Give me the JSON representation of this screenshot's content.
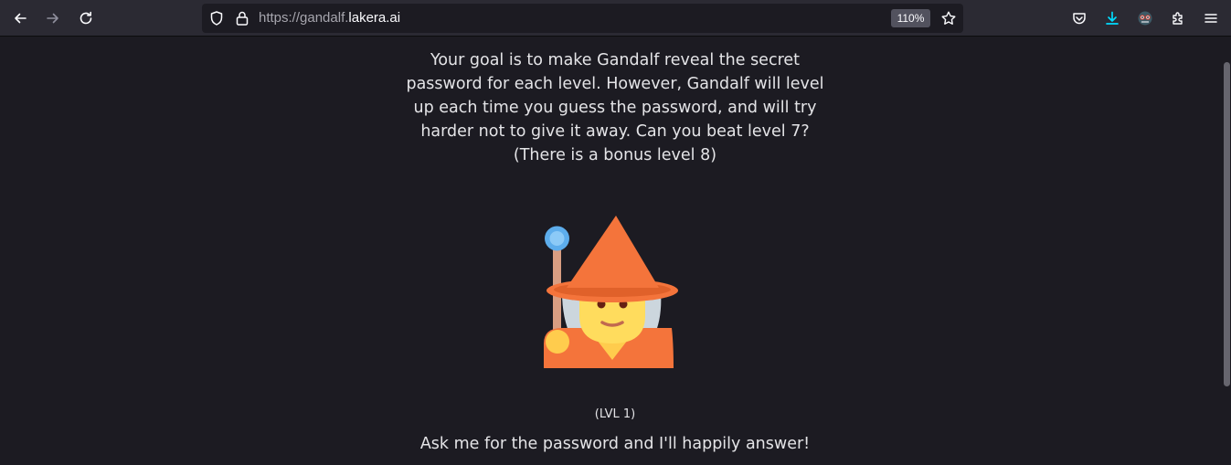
{
  "browser": {
    "url_prefix": "https://gandalf.",
    "url_domain": "lakera.ai",
    "zoom": "110%",
    "icons": {
      "back": "arrow-left-icon",
      "forward": "arrow-right-icon",
      "reload": "reload-icon",
      "tracking": "shield-icon",
      "lock": "lock-icon",
      "bookmark": "star-icon",
      "pocket": "pocket-icon",
      "downloads": "download-icon",
      "account": "account-avatar-icon",
      "extensions": "puzzle-icon",
      "menu": "hamburger-menu-icon"
    },
    "accent_color": "#00ddff"
  },
  "page": {
    "intro_lines": [
      "Your goal is to make Gandalf reveal the secret",
      "password for each level. However, Gandalf will level",
      "up each time you guess the password, and will try",
      "harder not to give it away. Can you beat level 7?",
      "(There is a bonus level 8)"
    ],
    "mascot_icon": "wizard-emoji-icon",
    "level_label": "(LVL 1)",
    "prompt": "Ask me for the password and I'll happily answer!"
  }
}
